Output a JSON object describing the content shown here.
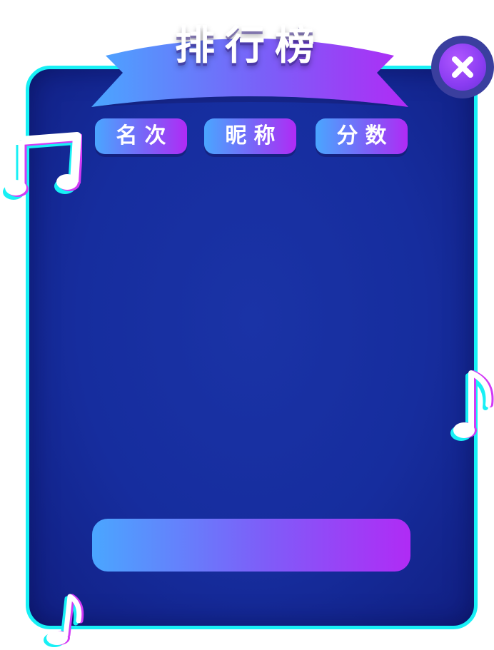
{
  "leaderboard": {
    "title": "排行榜",
    "columns": {
      "rank": "名次",
      "nickname": "昵称",
      "score": "分数"
    }
  },
  "colors": {
    "frame": "#18f0f5",
    "panel": "#162d9e",
    "gradient_start": "#4aa6ff",
    "gradient_end": "#b02bf5"
  },
  "icons": {
    "close": "close-icon",
    "note_a": "music-note-icon",
    "note_b": "music-note-icon",
    "note_c": "music-note-icon"
  }
}
